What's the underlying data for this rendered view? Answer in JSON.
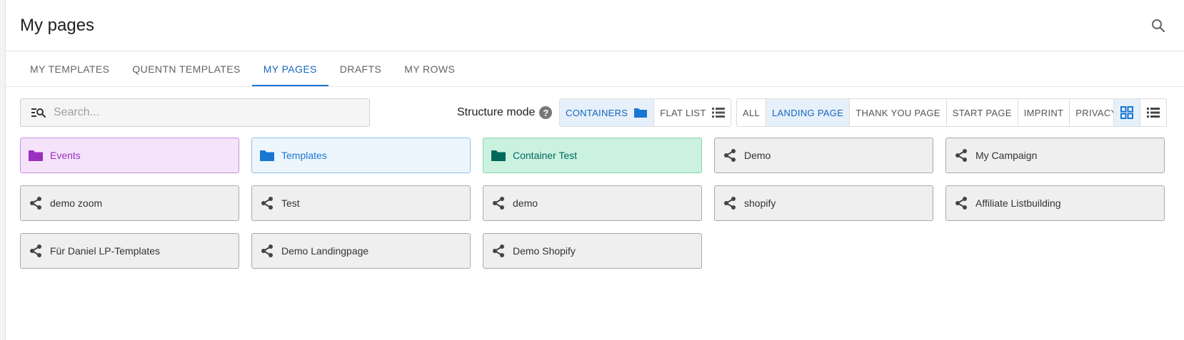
{
  "header": {
    "title": "My pages"
  },
  "tabs": [
    {
      "label": "MY TEMPLATES",
      "active": false
    },
    {
      "label": "QUENTN TEMPLATES",
      "active": false
    },
    {
      "label": "MY PAGES",
      "active": true
    },
    {
      "label": "DRAFTS",
      "active": false
    },
    {
      "label": "MY ROWS",
      "active": false
    }
  ],
  "search": {
    "placeholder": "Search...",
    "value": ""
  },
  "structure_mode": {
    "label": "Structure mode",
    "help": "?",
    "options": [
      {
        "label": "CONTAINERS",
        "active": true,
        "icon": "folder-icon"
      },
      {
        "label": "FLAT LIST",
        "active": false,
        "icon": "list-icon"
      }
    ]
  },
  "filters": [
    {
      "label": "ALL",
      "active": false
    },
    {
      "label": "LANDING PAGE",
      "active": true
    },
    {
      "label": "THANK YOU PAGE",
      "active": false
    },
    {
      "label": "START PAGE",
      "active": false
    },
    {
      "label": "IMPRINT",
      "active": false
    },
    {
      "label": "PRIVACY",
      "active": false
    }
  ],
  "view_toggle": [
    {
      "name": "grid-view",
      "icon": "grid-icon",
      "active": true
    },
    {
      "name": "list-view",
      "icon": "list-icon",
      "active": false
    }
  ],
  "colors": {
    "accent": "#1976d2",
    "purple": "#9b2fbf",
    "blue": "#1976d2",
    "green": "#00695c"
  },
  "items": [
    {
      "label": "Events",
      "type": "folder",
      "color": "purple"
    },
    {
      "label": "Templates",
      "type": "folder",
      "color": "blue"
    },
    {
      "label": "Container Test",
      "type": "folder",
      "color": "green"
    },
    {
      "label": "Demo",
      "type": "share"
    },
    {
      "label": "My Campaign",
      "type": "share"
    },
    {
      "label": "demo zoom",
      "type": "share"
    },
    {
      "label": "Test",
      "type": "share"
    },
    {
      "label": "demo",
      "type": "share"
    },
    {
      "label": "shopify",
      "type": "share"
    },
    {
      "label": "Affiliate Listbuilding",
      "type": "share"
    },
    {
      "label": "Für Daniel LP-Templates",
      "type": "share"
    },
    {
      "label": "Demo Landingpage",
      "type": "share"
    },
    {
      "label": "Demo Shopify",
      "type": "share"
    }
  ]
}
